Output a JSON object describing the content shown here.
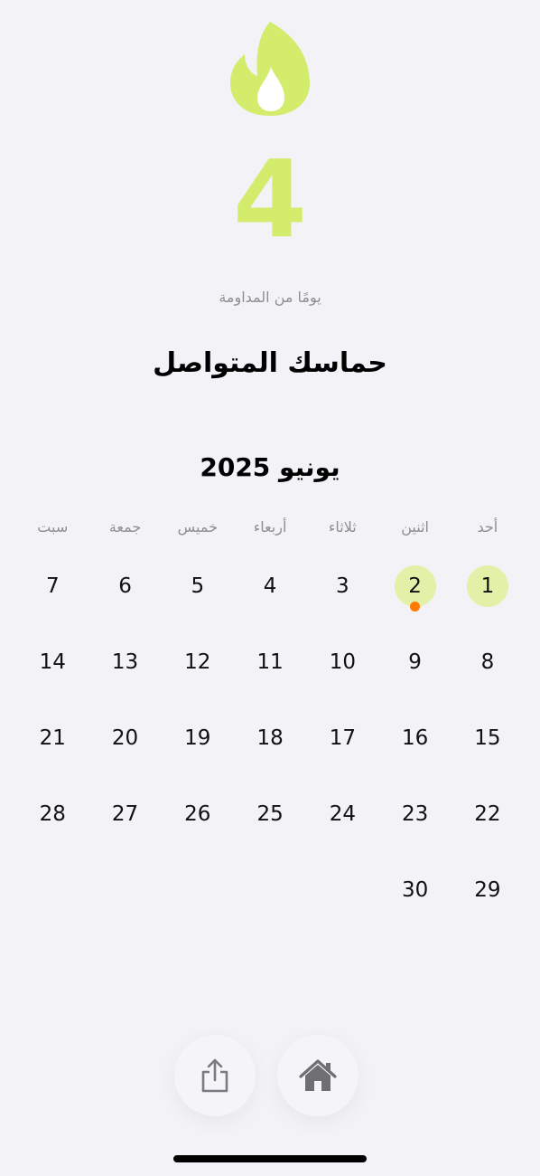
{
  "streak": {
    "icon": "flame-icon",
    "count": "4",
    "caption": "يومًا من المداومة",
    "headline": "حماسك المتواصل"
  },
  "calendar": {
    "month_title": "يونيو 2025",
    "weekdays": [
      "أحد",
      "اثنين",
      "ثلاثاء",
      "أربعاء",
      "خميس",
      "جمعة",
      "سبت"
    ],
    "days": [
      {
        "day": "1",
        "done": true,
        "today": false
      },
      {
        "day": "2",
        "done": true,
        "today": true
      },
      {
        "day": "3"
      },
      {
        "day": "4"
      },
      {
        "day": "5"
      },
      {
        "day": "6"
      },
      {
        "day": "7"
      },
      {
        "day": "8"
      },
      {
        "day": "9"
      },
      {
        "day": "10"
      },
      {
        "day": "11"
      },
      {
        "day": "12"
      },
      {
        "day": "13"
      },
      {
        "day": "14"
      },
      {
        "day": "15"
      },
      {
        "day": "16"
      },
      {
        "day": "17"
      },
      {
        "day": "18"
      },
      {
        "day": "19"
      },
      {
        "day": "20"
      },
      {
        "day": "21"
      },
      {
        "day": "22"
      },
      {
        "day": "23"
      },
      {
        "day": "24"
      },
      {
        "day": "25"
      },
      {
        "day": "26"
      },
      {
        "day": "27"
      },
      {
        "day": "28"
      },
      {
        "day": "29"
      },
      {
        "day": "30"
      }
    ]
  },
  "actions": {
    "share_icon": "share-icon",
    "home_icon": "home-icon"
  },
  "colors": {
    "accent": "#D4EC6C",
    "done_day": "#E3F0A7",
    "today_dot": "#FF7A00",
    "background": "#F2F2F7",
    "muted_text": "#8E8E93"
  }
}
